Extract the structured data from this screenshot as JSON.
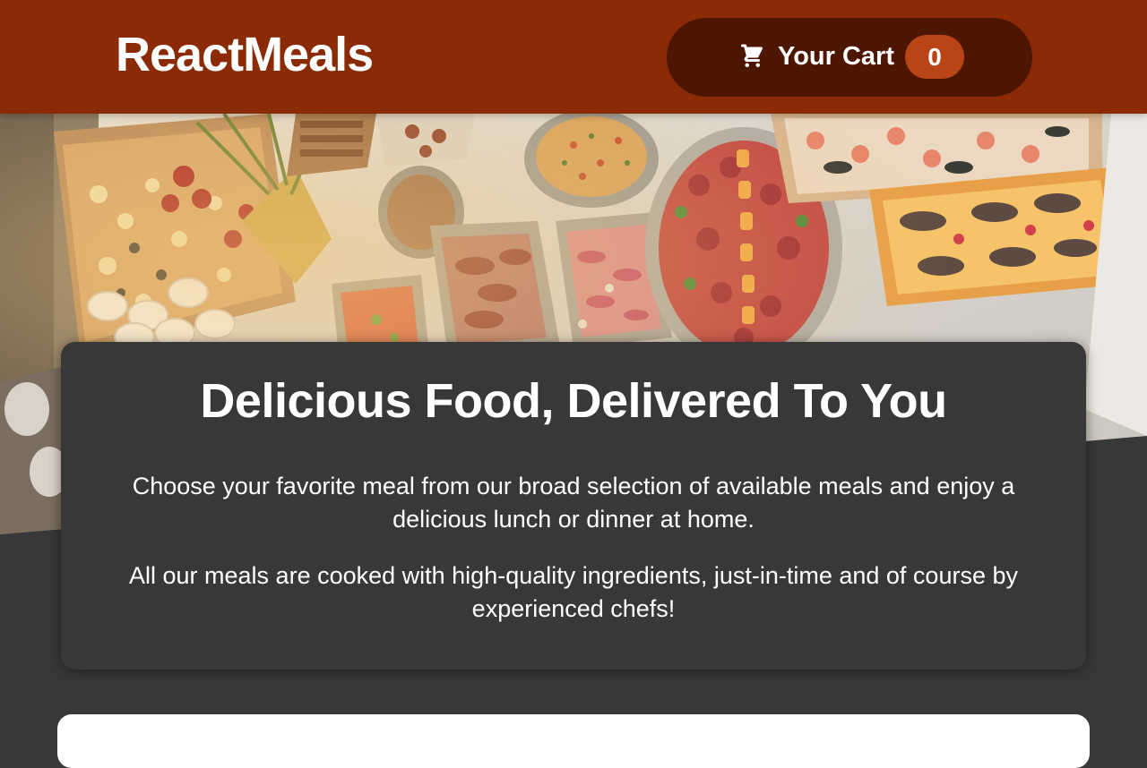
{
  "header": {
    "logo": "ReactMeals",
    "cart": {
      "label": "Your Cart",
      "count": "0",
      "icon": "cart-icon"
    }
  },
  "hero": {
    "image_alt": "A table full of delicious food!"
  },
  "summary": {
    "title": "Delicious Food, Delivered To You",
    "paragraph_1": "Choose your favorite meal from our broad selection of available meals and enjoy a delicious lunch or dinner at home.",
    "paragraph_2": "All our meals are cooked with high-quality ingredients, just-in-time and of course by experienced chefs!"
  },
  "colors": {
    "header_bg": "#8a2b06",
    "cart_bg": "#4d1601",
    "badge_bg": "#b94517",
    "page_bg": "#383838",
    "text": "#ffffff"
  }
}
